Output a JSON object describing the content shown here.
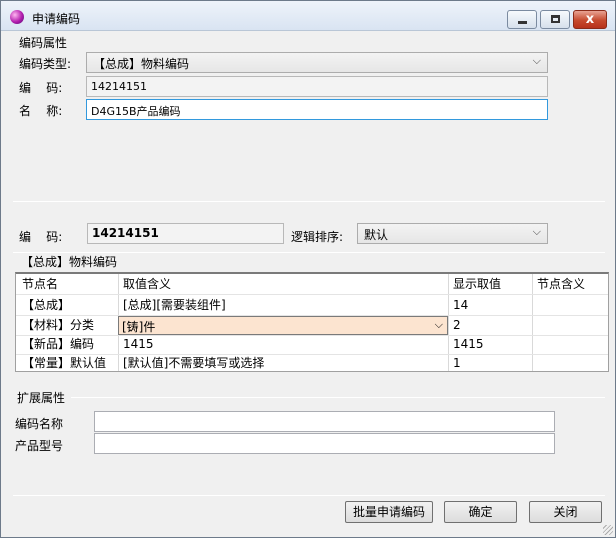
{
  "window": {
    "title": "申请编码",
    "minimize": "–",
    "maximize": "□",
    "close": "x"
  },
  "code_props": {
    "section": "编码属性",
    "type_label": "编码类型:",
    "type_value": "【总成】物料编码",
    "code_label": "编    码:",
    "code_value": "14214151",
    "name_label": "名    称:",
    "name_value": "D4G15B产品编码"
  },
  "mid": {
    "code_label": "编    码:",
    "code_value": "14214151",
    "sort_label": "逻辑排序:",
    "sort_value": "默认"
  },
  "grid": {
    "section": "【总成】物料编码",
    "headers": [
      "节点名",
      "取值含义",
      "显示取值",
      "节点含义"
    ],
    "rows": [
      {
        "node": "【总成】",
        "meaning": "[总成][需要装组件]",
        "display": "14",
        "node_meaning": ""
      },
      {
        "node": "【材料】分类",
        "meaning": "[铸]件",
        "display": "2",
        "node_meaning": ""
      },
      {
        "node": "【新品】编码",
        "meaning": "1415",
        "display": "1415",
        "node_meaning": ""
      },
      {
        "node": "【常量】默认值",
        "meaning": "[默认值]不需要填写或选择",
        "display": "1",
        "node_meaning": ""
      }
    ]
  },
  "ext": {
    "section": "扩展属性",
    "code_name_label": "编码名称",
    "code_name_value": "",
    "model_label": "产品型号",
    "model_value": ""
  },
  "buttons": {
    "batch": "批量申请编码",
    "ok": "确定",
    "close": "关闭"
  },
  "colors": {
    "edit_cell": "#fce4d0",
    "focus_border": "#3399dd"
  },
  "icons": [
    "app-icon",
    "dropdown-arrow-icon"
  ]
}
